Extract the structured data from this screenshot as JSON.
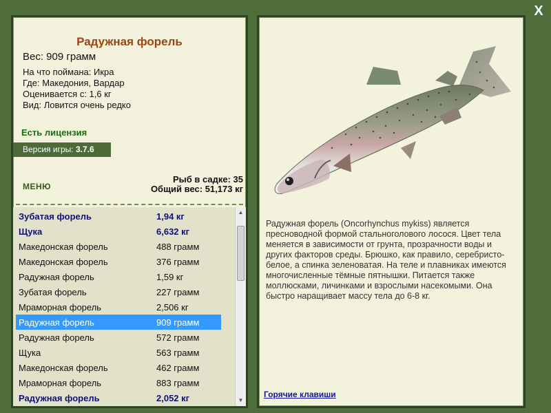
{
  "close_label": "X",
  "fish": {
    "name": "Радужная форель",
    "weight": "Вес: 909 грамм",
    "details": [
      "На что поймана: Икра",
      "Где: Македония, Вардар",
      "Оценивается с: 1,6 кг",
      "Вид: Ловится очень редко"
    ]
  },
  "license": "Есть лицензия",
  "version": {
    "label": "Версия игры: ",
    "number": "3.7.6"
  },
  "menu_label": "МЕНЮ",
  "totals": {
    "count": "Рыб в садке: 35",
    "weight": "Общий вес: 51,173 кг"
  },
  "catch_list": [
    {
      "name": "Зубатая форель",
      "value": "1,94 кг",
      "highlight": true
    },
    {
      "name": "Щука",
      "value": "6,632 кг",
      "highlight": true
    },
    {
      "name": "Македонская форель",
      "value": "488 грамм",
      "highlight": false
    },
    {
      "name": "Македонская форель",
      "value": "376 грамм",
      "highlight": false
    },
    {
      "name": "Радужная форель",
      "value": "1,59 кг",
      "highlight": false
    },
    {
      "name": "Зубатая форель",
      "value": "227 грамм",
      "highlight": false
    },
    {
      "name": "Мраморная форель",
      "value": "2,506 кг",
      "highlight": false
    },
    {
      "name": "Радужная форель",
      "value": "909 грамм",
      "highlight": false,
      "selected": true
    },
    {
      "name": "Радужная форель",
      "value": "572 грамм",
      "highlight": false
    },
    {
      "name": "Щука",
      "value": "563 грамм",
      "highlight": false
    },
    {
      "name": "Македонская форель",
      "value": "462 грамм",
      "highlight": false
    },
    {
      "name": "Мраморная форель",
      "value": "883 грамм",
      "highlight": false
    },
    {
      "name": "Радужная форель",
      "value": "2,052 кг",
      "highlight": true
    }
  ],
  "description": "Радужная форель (Oncorhynchus mykiss) является пресноводной формой стальноголового лосося. Цвет тела меняется в зависимости от грунта, прозрачности воды и других факторов среды. Брюшко, как правило, серебристо-белое, а спинка зеленоватая. На теле и плавниках имеются многочисленные тёмные пятнышки. Питается также моллюсками, личинками и взрослыми насекомыми. Она быстро наращивает массу тела до 6-8 кг.",
  "hotkeys_label": "Горячие клавиши",
  "colors": {
    "background": "#4e6d3a",
    "panel": "#f3f2dc",
    "title": "#a0430f",
    "license": "#1e6a12",
    "selection": "#3399ff",
    "highlight_text": "#10107a"
  }
}
